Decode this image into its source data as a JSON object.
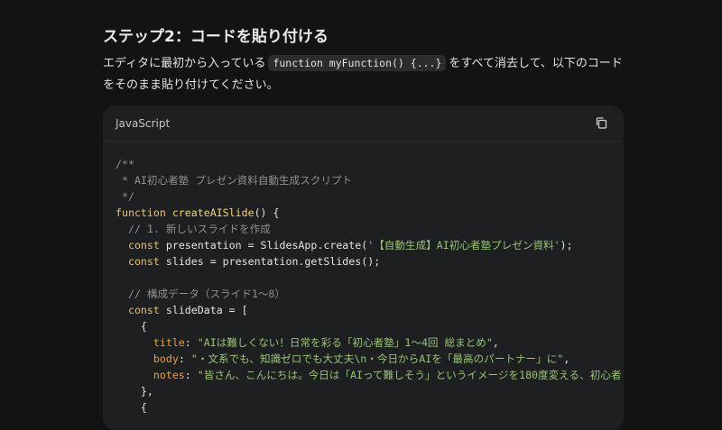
{
  "heading": "ステップ2：コードを貼り付ける",
  "paragraph": {
    "before": "エディタに最初から入っている",
    "inline_code": "function myFunction() {...}",
    "after": "をすべて消去して、以下のコードをそのまま貼り付けてください。"
  },
  "code_block": {
    "language": "JavaScript",
    "copy_icon": "copy-icon",
    "lines": {
      "l1": "/**",
      "l2": " * AI初心者塾 プレゼン資料自動生成スクリプト",
      "l3": " */",
      "l4_kw": "function",
      "l4_fn": "createAISlide",
      "l4_rest": "() {",
      "l5": "  // 1. 新しいスライドを作成",
      "l6_kw": "  const",
      "l6_mid": " presentation = SlidesApp.create(",
      "l6_str": "'【自動生成】AI初心者塾プレゼン資料'",
      "l6_end": ");",
      "l7_kw": "  const",
      "l7_rest": " slides = presentation.getSlides();",
      "l8": "",
      "l9": "  // 構成データ（スライド1〜8）",
      "l10_kw": "  const",
      "l10_rest": " slideData = [",
      "l11": "    {",
      "l12_prop": "      title",
      "l12_colon": ": ",
      "l12_str": "\"AIは難しくない！日常を彩る「初心者塾」1〜4回 総まとめ\"",
      "l12_end": ",",
      "l13_prop": "      body",
      "l13_colon": ": ",
      "l13_str": "\"・文系でも、知識ゼロでも大丈夫\\n・今日からAIを「最高のパートナー」に\"",
      "l13_end": ",",
      "l14_prop": "      notes",
      "l14_colon": ": ",
      "l14_str": "\"皆さん、こんにちは。今日は「AIって難しそう」というイメージを180度変える、初心者",
      "l15": "    },",
      "l16": "    {"
    }
  }
}
